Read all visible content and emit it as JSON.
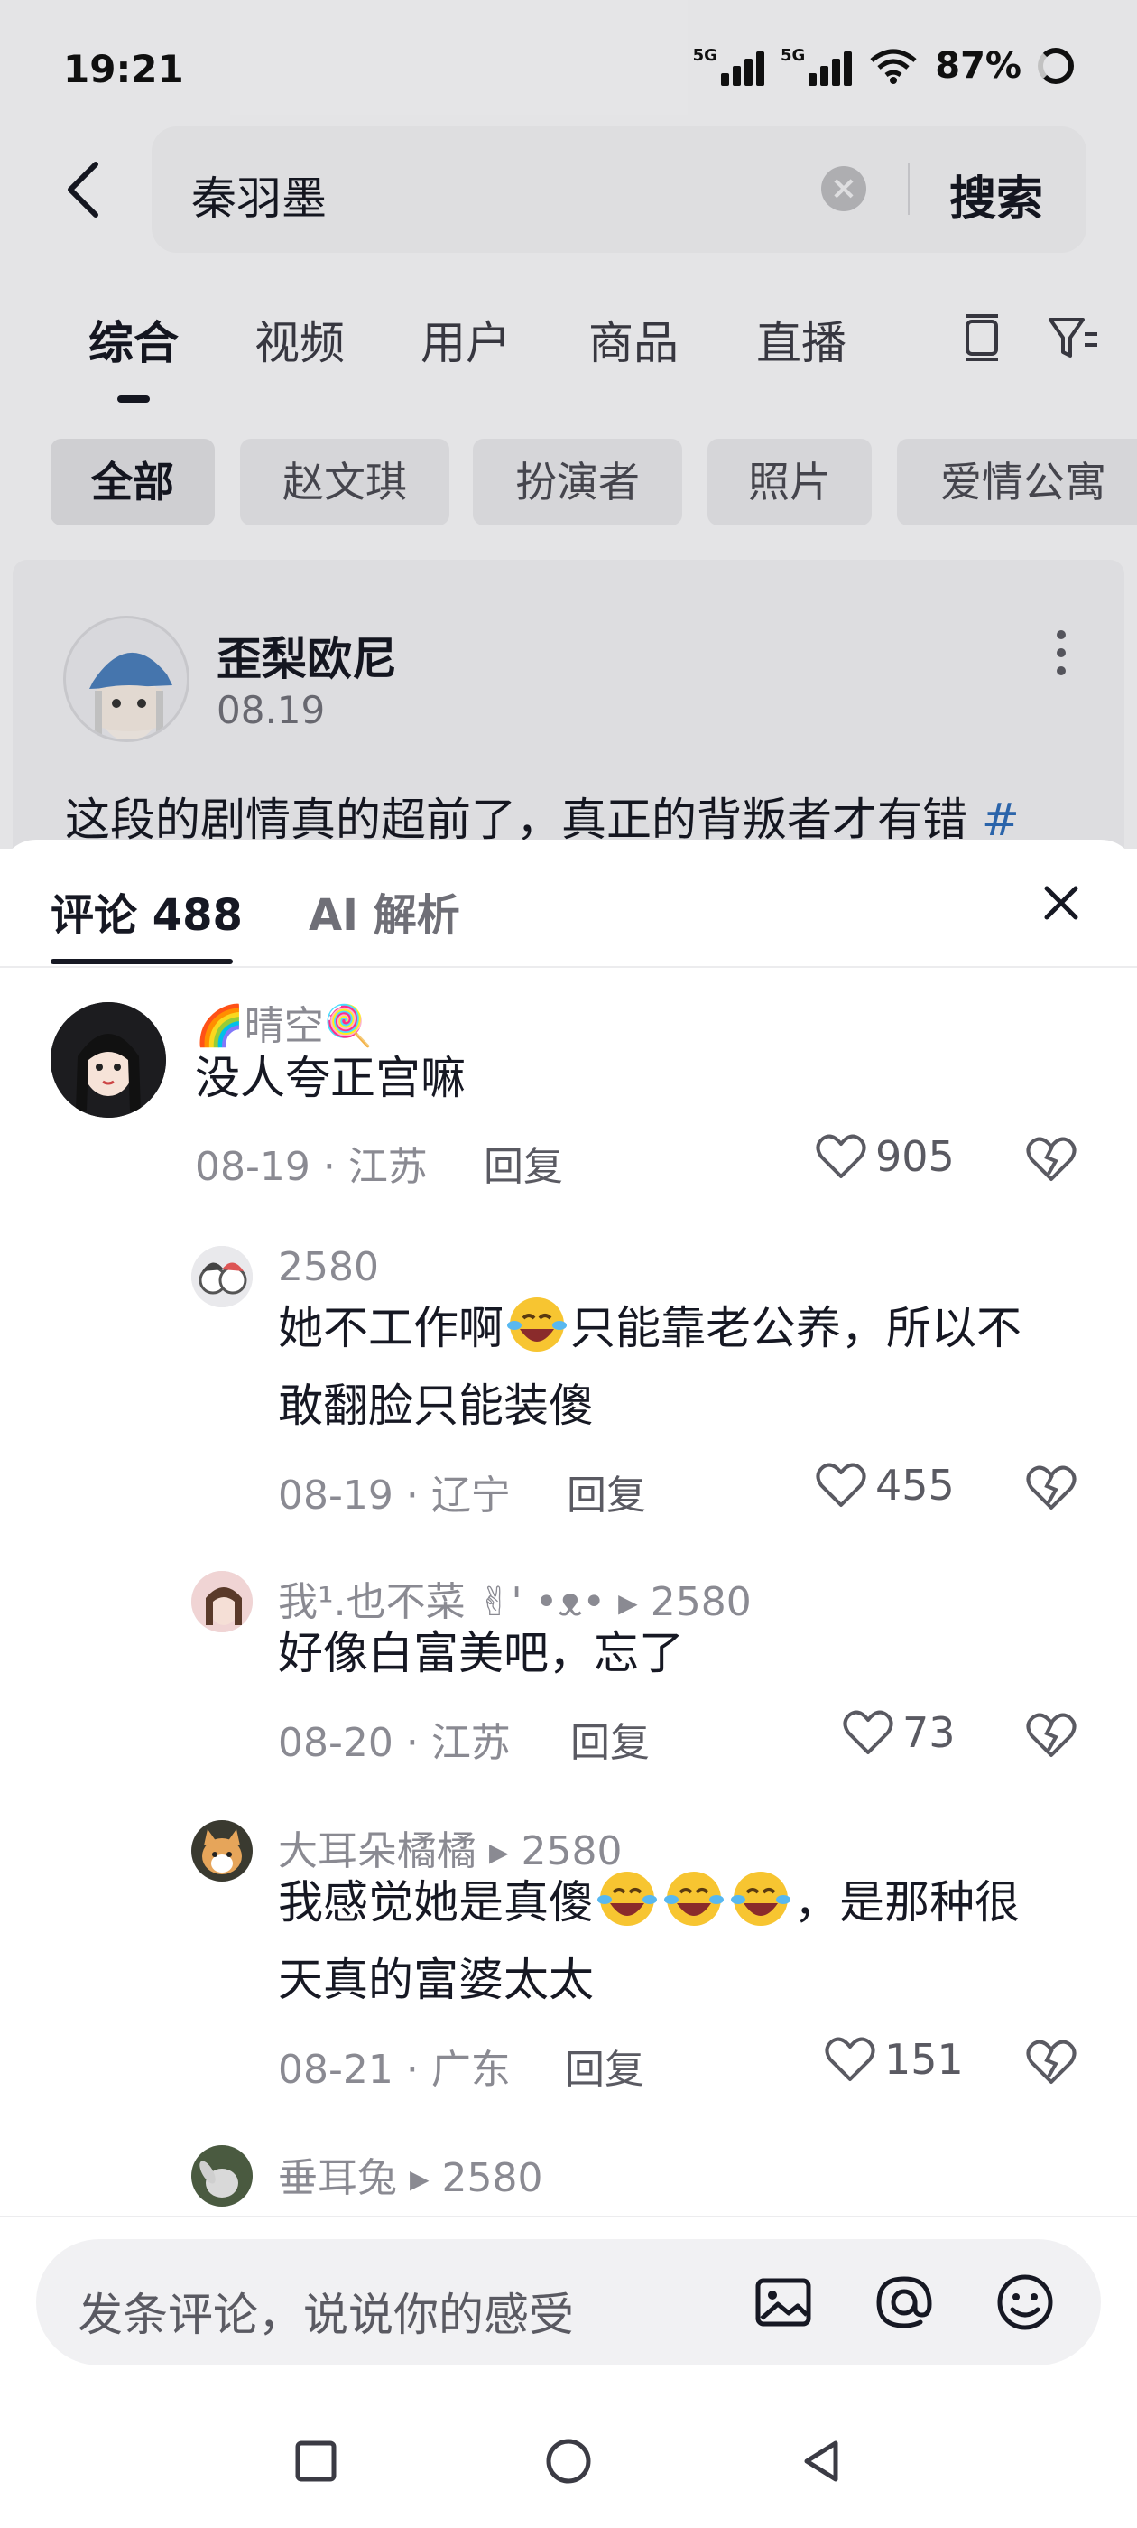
{
  "status": {
    "time": "19:21",
    "network1": "5G",
    "network2": "5G",
    "battery": "87%"
  },
  "search": {
    "query": "秦羽墨",
    "button": "搜索",
    "clear_icon": "close-circle-icon",
    "back_icon": "chevron-left-icon"
  },
  "tabs": [
    {
      "label": "综合",
      "active": true
    },
    {
      "label": "视频"
    },
    {
      "label": "用户"
    },
    {
      "label": "商品"
    },
    {
      "label": "直播"
    }
  ],
  "chips": [
    "全部",
    "赵文琪",
    "扮演者",
    "照片",
    "爱情公寓"
  ],
  "post": {
    "author": "歪梨欧尼",
    "date": "08.19",
    "text": "这段的剧情真的超前了，真正的背叛者才有错",
    "hash": "#"
  },
  "sheet": {
    "tab_comments": "评论 488",
    "tab_ai": "AI 解析",
    "close_icon": "close-icon"
  },
  "comments": [
    {
      "user": "🌈晴空🍭",
      "text": "没人夸正宫嘛",
      "date": "08-19 · 江苏",
      "reply": "回复",
      "likes": "905"
    },
    {
      "user": "2580",
      "text_line1a": "她不工作啊",
      "text_line1b": "只能靠老公养，所以不",
      "text_line2": "敢翻脸只能装傻",
      "date": "08-19 · 辽宁",
      "reply": "回复",
      "likes": "455"
    },
    {
      "user": "我¹.也不菜 ✌' •ᴥ•",
      "to": "2580",
      "text": "好像白富美吧，忘了",
      "date": "08-20 · 江苏",
      "reply": "回复",
      "likes": "73"
    },
    {
      "user": "大耳朵橘橘",
      "to": "2580",
      "text_line1a": "我感觉她是真傻",
      "text_line1b": "，是那种很",
      "text_line2": "天真的富婆太太",
      "date": "08-21 · 广东",
      "reply": "回复",
      "likes": "151"
    },
    {
      "user": "垂耳兔",
      "to": "2580"
    }
  ],
  "input": {
    "placeholder": "发条评论，说说你的感受",
    "icons": [
      "image-icon",
      "at-icon",
      "emoji-icon"
    ]
  },
  "navbar": [
    "square-icon",
    "circle-icon",
    "triangle-back-icon"
  ],
  "colors": {
    "link": "#2e6bb5",
    "muted": "#8a8a92",
    "text": "#161823"
  }
}
